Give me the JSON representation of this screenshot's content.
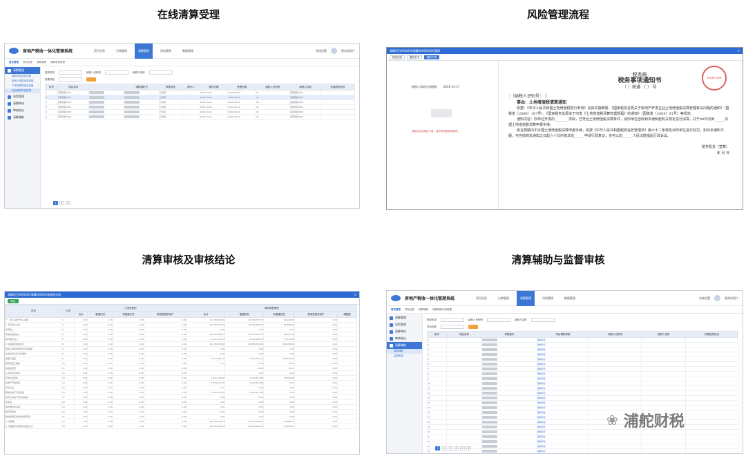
{
  "captions": {
    "top_left": "在线清算受理",
    "top_right": "风险管理流程",
    "bottom_left": "清算审核及审核结论",
    "bottom_right": "清算辅助与监督审核"
  },
  "app": {
    "title": "房地产税收一体化管理系统",
    "nav": [
      "项目信息",
      "日常管理",
      "清算管理",
      "风险管理",
      "数据管理"
    ],
    "user_settings": "系统设置",
    "user_name": "税务局用户"
  },
  "panel1": {
    "crumb": [
      "首页管理",
      "项目信息",
      "清算管理",
      "清算申报受理"
    ],
    "sidebar": [
      "清算管理",
      "风险管理",
      "清算审核",
      "审核结论",
      "清算辅助"
    ],
    "sub": [
      "清算项目信息采集",
      "纳税人清算信息采集",
      "尸清算清算信息采集",
      "在线清算申报受理"
    ],
    "filters": [
      "税务机关",
      "纳税人识别号",
      "纳税人名称",
      "受理状态"
    ],
    "headers": [
      "序号",
      "项目名称",
      "",
      "清算通知书",
      "审核状态",
      "操作人",
      "操作日期",
      "受理日期",
      "纳税人识别号",
      "纳税人名称",
      "所属税务机关"
    ],
    "rows": [
      [
        "1",
        "清算项目0001",
        "已清算",
        "2020-09-21",
        "91",
        "清算项目0001"
      ],
      [
        "2",
        "清算项目0002",
        "已清算",
        "2020-09-21",
        "91",
        "清算项目0002"
      ],
      [
        "3",
        "清算项目0003",
        "已清算",
        "2020-09-21",
        "91",
        "清算项目0003"
      ],
      [
        "4",
        "清算项目0004",
        "已清算",
        "2020-09-21",
        "91",
        "清算项目0004"
      ],
      [
        "5",
        "清算项目0005",
        "已清算",
        "2020-09-21",
        "91",
        "清算项目0005"
      ],
      [
        "6",
        "清算项目0006",
        "已清算",
        "2020-09-21",
        "91",
        "清算项目0006"
      ]
    ],
    "pager": [
      "1",
      "2",
      "3"
    ]
  },
  "panel2": {
    "window_title": "清算项目0000256清算000000风险管理",
    "tools": [
      "风险识别",
      "整改文书",
      "整改下发"
    ],
    "left_label": "纳税人风险应对期限：",
    "left_date": "2020-12-17",
    "left_note": "风险应对完成后下发，若不符合条件请修改。",
    "doc_org": "税务局",
    "doc_title": "税务事项通知书",
    "doc_no": "（      ）税通 〔    〕    号",
    "doc_to": "：（纳税人识别号：                 ）",
    "doc_subject": "事由：土地增值税清算通知",
    "doc_body1": "依据：《中华人民共和国土地增值税暂行条例》及其实施细则、《国家税务总局关于房地产开发企业土地增值税清算管理有关问题的通知》（国税发〔2006〕187号）、《国家税务总局关于印发《土地增值税清算管理规程》的通知》（国税发〔2009〕91号）等规定。",
    "doc_body2": "通知内容：你单位开发的________项目，已符合土地增值税清算条件，请你单位自收到本通知起有关规定进行清算，并于90日内到______办理土地增值税清算申报手续。",
    "doc_body3": "如在规期内不办理土地增值税清算申报手续，将按《中华人民共和国税收征收管理法》第六十二条规定对你单位进行处罚。如对本通知不服，可自收到本通知之日起六十日内依法向______申请行政复议；也可以向______人民法院提起行政诉讼。",
    "doc_sign": "税务机关（签章）",
    "doc_date": "年   月   日",
    "stamp_text": "税务局专用章"
  },
  "panel3": {
    "window_title": "清算项目0000005清算000005审核结论表",
    "export_label": "导出",
    "col_groups": [
      "项目",
      "行次",
      "已出售面积",
      "视同销售面积"
    ],
    "sub_headers": [
      "合计",
      "普通住宅",
      "非普通住宅",
      "其他类型房地产",
      "合计",
      "普通住宅",
      "非普通住宅",
      "其他类型房地产",
      "调整数"
    ],
    "rows": [
      {
        "label": "一、转让房地产收入总额",
        "line": "1",
        "vals": [
          "0.00",
          "0.00",
          "0.00",
          "0.00",
          "14,776,874.00",
          "14,716,377.07",
          "60,236.36",
          "0.00"
        ]
      },
      {
        "label": "1. 转让收入合计",
        "line": "2",
        "vals": [
          "0.00",
          "0.00",
          "0.00",
          "0.00",
          "12,795,872.36",
          "12,695,586.29",
          "80,868.03",
          "0.00"
        ]
      },
      {
        "label": "货币收入",
        "line": "3",
        "vals": [
          "0.00",
          "0.00",
          "0.00",
          "0.00",
          "0.00",
          "0.00",
          "0.00",
          "0.00"
        ]
      },
      {
        "label": "实物及其他收入",
        "line": "4",
        "vals": [
          "0.00",
          "0.00",
          "0.00",
          "0.00",
          "20,251,848.07",
          "20,285,781.76",
          "66,657.32",
          "0.00"
        ]
      },
      {
        "label": "视同销售收入",
        "line": "5",
        "vals": [
          "0.00",
          "0.00",
          "0.00",
          "0.00",
          "2,551,519.25",
          "2,514,286.75",
          "17,136.50",
          "0.00"
        ]
      },
      {
        "label": "2. 扣除项目金额合计",
        "line": "6",
        "vals": [
          "0.00",
          "0.00",
          "0.00",
          "0.00",
          "64,145,893.80",
          "62,895,613.69",
          "352,280.30",
          "0.00"
        ]
      },
      {
        "label": "取得土地使用权所支付的金额",
        "line": "7",
        "vals": [
          "0.00",
          "0.00",
          "0.00",
          "0.00",
          "0.00",
          "0.00",
          "0.00",
          "0.00"
        ]
      },
      {
        "label": "土地征用及拆迁补偿费",
        "line": "8",
        "vals": [
          "0.00",
          "0.00",
          "0.00",
          "0.00",
          "0.00",
          "0.00",
          "0.00",
          "0.00"
        ]
      },
      {
        "label": "前期工程费",
        "line": "9",
        "vals": [
          "0.00",
          "0.00",
          "0.00",
          "0.00",
          "1,677,261.87",
          "3,230,531.12",
          "188,835.31",
          "0.00"
        ]
      },
      {
        "label": "建筑安装工程费",
        "line": "10",
        "vals": [
          "0.00",
          "0.00",
          "0.00",
          "0.00",
          "1.76",
          "1.76",
          "12.72",
          "0.00"
        ]
      },
      {
        "label": "基础设施费",
        "line": "11",
        "vals": [
          "0.00",
          "0.00",
          "0.00",
          "0.00",
          "-",
          "20.03",
          "21.51",
          "0.00"
        ]
      },
      {
        "label": "公共配套设施费",
        "line": "12",
        "vals": [
          "0.00",
          "0.00",
          "0.00",
          "0.00",
          "-",
          "0.00",
          "0.00",
          "0.00"
        ]
      },
      {
        "label": "开发间接费用",
        "line": "13",
        "vals": [
          "0.00",
          "0.00",
          "0.00",
          "0.00",
          "1,621,599.85",
          "1,574,527.85",
          "90,890.46",
          "0.00"
        ]
      },
      {
        "label": "房地产开发费用",
        "line": "14",
        "vals": [
          "0.00",
          "0.00",
          "0.00",
          "0.00",
          "1,530,527.85",
          "1,530,527.85",
          "0.00",
          "0.00"
        ]
      },
      {
        "label": "利息支出",
        "line": "15",
        "vals": [
          "0.00",
          "0.00",
          "0.00",
          "0.00",
          "0.00",
          "0.00",
          "0.00",
          "0.00"
        ]
      },
      {
        "label": "其他房地产开发费用",
        "line": "16",
        "vals": [
          "0.00",
          "0.00",
          "0.00",
          "0.00",
          "1,530,527.85",
          "1,530,527.85",
          "0.00",
          "0.00"
        ]
      },
      {
        "label": "与转让房地产有关的税金",
        "line": "17",
        "vals": [
          "0.00",
          "0.00",
          "0.00",
          "0.00",
          "0.00",
          "0.00",
          "0.00",
          "0.00"
        ]
      },
      {
        "label": "营业税",
        "line": "18",
        "vals": [
          "0.00",
          "0.00",
          "0.00",
          "0.00",
          "0.00",
          "0.00",
          "0.00",
          "0.00"
        ]
      },
      {
        "label": "城市维护建设税",
        "line": "19",
        "vals": [
          "0.00",
          "0.00",
          "0.00",
          "0.00",
          "0.00",
          "0.00",
          "0.00",
          "0.00"
        ]
      },
      {
        "label": "教育费附加",
        "line": "20",
        "vals": [
          "0.00",
          "0.00",
          "0.00",
          "0.00",
          "0.00",
          "0.00",
          "0.00",
          "0.00"
        ]
      },
      {
        "label": "财政部规定的其他扣除项目",
        "line": "21",
        "vals": [
          "0.00",
          "0.00",
          "0.00",
          "0.00",
          "0.00",
          "0.00",
          "0.00",
          "0.00"
        ]
      },
      {
        "label": "3. 增值额",
        "line": "22",
        "vals": [
          "0.00",
          "0.00",
          "0.00",
          "0.00",
          "16,230,038.53",
          "16,233,068.53",
          "116,869.37",
          "0.00"
        ]
      },
      {
        "label": "4. 增值额与扣除项目金额之比",
        "line": "23",
        "vals": [
          "0.00",
          "0.00",
          "0.00",
          "0.00",
          "16,230,038.53",
          "16,239,995.54",
          "23,859.37",
          "0.00"
        ]
      }
    ]
  },
  "panel4": {
    "crumb": [
      "首页管理",
      "项目信息",
      "清算辅助",
      "清算辅助申报受理"
    ],
    "sidebar": [
      "清算管理",
      "风险管理",
      "清算审核",
      "审核结论",
      "清算辅助"
    ],
    "sub": [
      "清算辅助",
      "监督审核"
    ],
    "filters": [
      "税务机关",
      "纳税人识别号",
      "纳税人名称",
      "项目名称"
    ],
    "headers": [
      "序号",
      "项目名称",
      "审核操作",
      "项目辅助审核",
      "纳税人识别号",
      "纳税人名称",
      "所属税务机关"
    ],
    "link_label": "查看项目",
    "rows": [
      "1",
      "2",
      "3",
      "4",
      "5",
      "6",
      "7",
      "8",
      "9",
      "10",
      "11",
      "12",
      "13",
      "14",
      "15",
      "16",
      "17",
      "18",
      "19",
      "20",
      "21",
      "22",
      "23",
      "24",
      "25",
      "26"
    ],
    "pager": [
      "1",
      "2",
      "3",
      "4",
      "5",
      "6"
    ]
  },
  "watermark": "浦舵财税"
}
